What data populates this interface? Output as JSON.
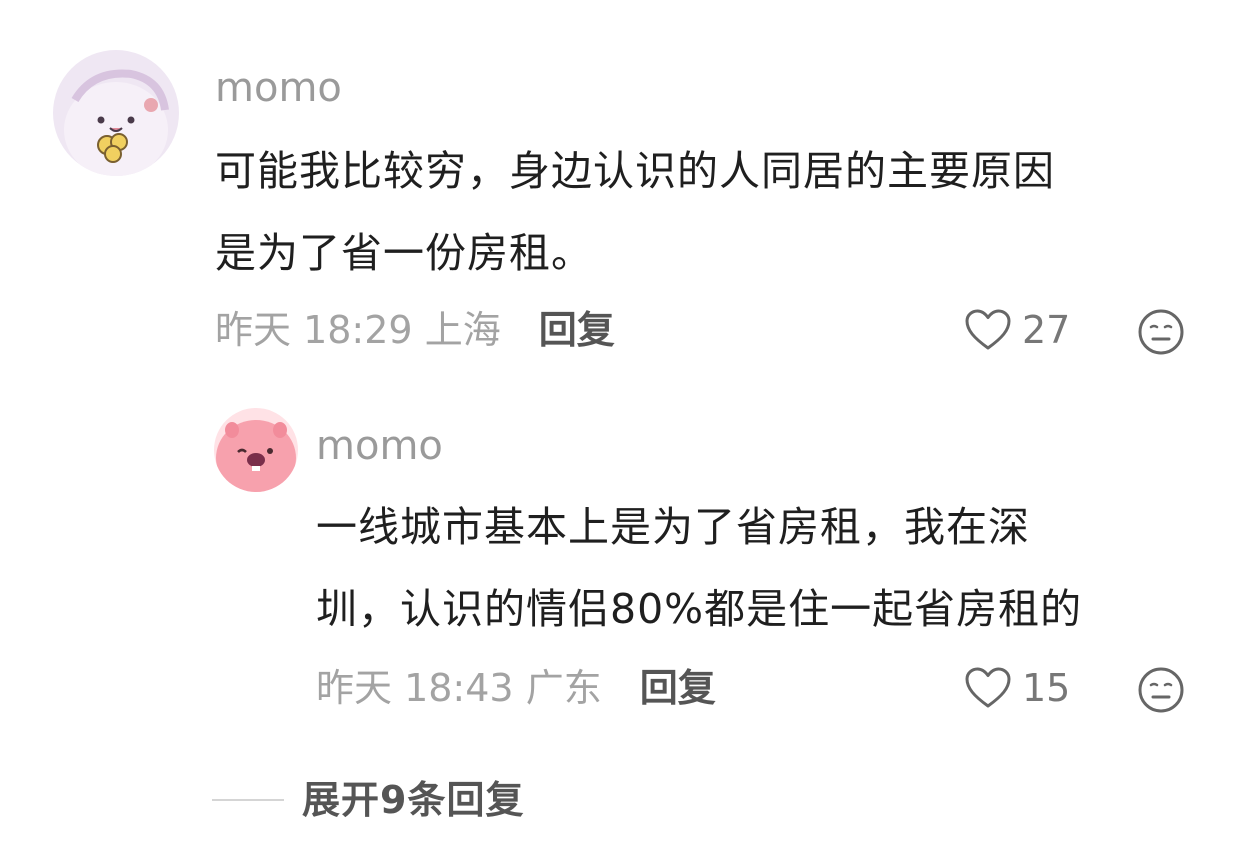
{
  "comments": [
    {
      "username": "momo",
      "content_lines": [
        "可能我比较穷，身边认识的人同居的主要原因",
        "是为了省一份房租。"
      ],
      "time": "昨天 18:29",
      "location": "上海",
      "reply_label": "回复",
      "likes": "27"
    },
    {
      "username": "momo",
      "content_lines": [
        "一线城市基本上是为了省房租，我在深",
        "圳，认识的情侣80%都是住一起省房租的"
      ],
      "time": "昨天 18:43",
      "location": "广东",
      "reply_label": "回复",
      "likes": "15"
    }
  ],
  "expand_replies_label": "展开9条回复",
  "icons": {
    "like": "heart-outline-icon",
    "emoji": "neutral-face-icon"
  },
  "colors": {
    "username": "#9a9a9a",
    "content": "#1f1f1f",
    "meta": "#a3a3a3",
    "reply": "#555555"
  }
}
